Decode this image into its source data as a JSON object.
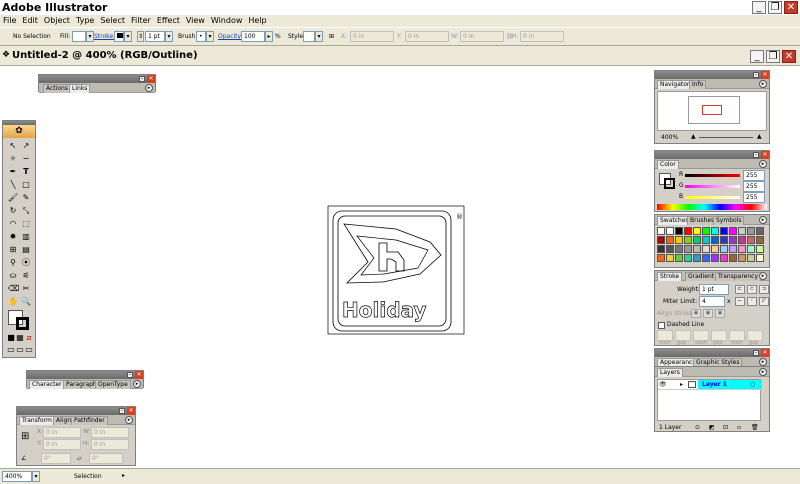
{
  "app": {
    "title": "Adobe Illustrator"
  },
  "menu": [
    "File",
    "Edit",
    "Object",
    "Type",
    "Select",
    "Filter",
    "Effect",
    "View",
    "Window",
    "Help"
  ],
  "control_bar": {
    "selection": "No Selection",
    "fill_label": "Fill:",
    "stroke_label": "Stroke:",
    "stroke_weight": "1 pt",
    "brush_label": "Brush:",
    "opacity_label": "Opacity:",
    "opacity_value": "100",
    "opacity_unit": "%",
    "style_label": "Style:",
    "x_label": "X:",
    "x_value": "0 in",
    "y_label": "Y:",
    "y_value": "0 in",
    "w_label": "W:",
    "w_value": "0 in",
    "h_label": "H:",
    "h_value": "0 in"
  },
  "document": {
    "title": "Untitled-2 @ 400% (RGB/Outline)"
  },
  "artwork": {
    "brand": "Holiday",
    "registered": "®"
  },
  "status": {
    "zoom": "400%",
    "mode": "Selection"
  },
  "panels": {
    "actions_links": {
      "tabs": [
        "Actions",
        "Links"
      ]
    },
    "navigator": {
      "tabs": [
        "Navigator",
        "Info"
      ],
      "zoom": "400%"
    },
    "color": {
      "tab": "Color",
      "channels": [
        {
          "label": "R",
          "value": "255"
        },
        {
          "label": "G",
          "value": "255"
        },
        {
          "label": "B",
          "value": "255"
        }
      ]
    },
    "swatches": {
      "tabs": [
        "Swatches",
        "Brushes",
        "Symbols"
      ]
    },
    "stroke": {
      "tabs": [
        "Stroke",
        "Gradient",
        "Transparency"
      ],
      "weight_label": "Weight:",
      "weight_value": "1 pt",
      "miter_label": "Miter Limit:",
      "miter_value": "4",
      "miter_unit": "x",
      "align_label": "Align Stroke:",
      "dashed_label": "Dashed Line",
      "dash_labels": [
        "dash",
        "gap",
        "dash",
        "gap",
        "dash",
        "gap"
      ]
    },
    "appearance": {
      "tabs": [
        "Appearance",
        "Graphic Styles"
      ]
    },
    "layers": {
      "tab": "Layers",
      "layer_name": "Layer 1",
      "footer": "1 Layer"
    },
    "character": {
      "tabs": [
        "Character",
        "Paragraph",
        "OpenType"
      ]
    },
    "transform": {
      "tabs": [
        "Transform",
        "Align",
        "Pathfinder"
      ],
      "x_label": "X:",
      "y_label": "Y:",
      "w_label": "W:",
      "h_label": "H:",
      "x_value": "0 in",
      "y_value": "0 in",
      "w_value": "0 in",
      "h_value": "0 in",
      "angle": "0°"
    }
  },
  "colors": {
    "accent_red": "#d93d22",
    "layer_highlight": "#00ffff",
    "stroke_link": "#1a3fb0"
  }
}
